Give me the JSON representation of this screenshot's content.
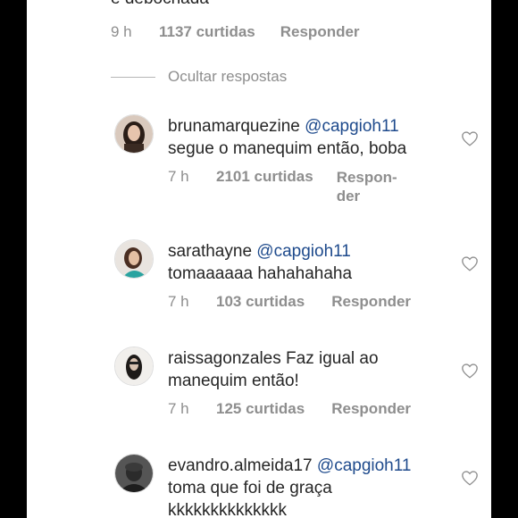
{
  "top_comment": {
    "text_tail": "e debochada",
    "time": "9 h",
    "likes": "1137 curtidas",
    "reply": "Responder"
  },
  "hide_replies": "Ocultar respostas",
  "replies": [
    {
      "username": "brunamarquezine",
      "mention": "@capgioh11",
      "text": "segue o manequim então, boba",
      "time": "7 h",
      "likes": "2101 curtidas",
      "reply_line1": "Respon-",
      "reply_line2": "der"
    },
    {
      "username": "sarathayne",
      "mention": "@capgioh11",
      "text": "tomaaaaaa hahahahaha",
      "time": "7 h",
      "likes": "103 curtidas",
      "reply": "Responder"
    },
    {
      "username": "raissagonzales",
      "text_line1": "Faz igual ao",
      "text_line2": "manequim então!",
      "time": "7 h",
      "likes": "125 curtidas",
      "reply": "Responder"
    },
    {
      "username": "evandro.almeida17",
      "mention": "@capgioh11",
      "text_line1": "toma que foi de graça",
      "text_line2": "kkkkkkkkkkkkkk"
    }
  ],
  "icons": {
    "avatar": "avatar",
    "like": "heart-outline-icon"
  },
  "colors": {
    "mention": "#1e4a8c",
    "secondary": "#8e8e8e",
    "text": "#262626"
  }
}
